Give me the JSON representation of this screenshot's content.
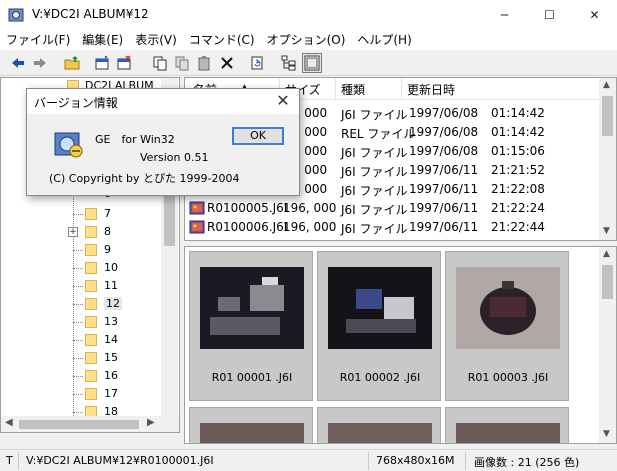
{
  "window": {
    "title": "V:¥DC2I ALBUM¥12",
    "minimize": "─",
    "maximize": "☐",
    "close": "✕"
  },
  "menu": [
    "ファイル(F)",
    "編集(E)",
    "表示(V)",
    "コマンド(C)",
    "オプション(O)",
    "ヘルプ(H)"
  ],
  "tree": {
    "root_label": "DC2I ALBUM",
    "items": [
      "7",
      "8",
      "9",
      "10",
      "11",
      "12",
      "13",
      "14",
      "15",
      "16",
      "17",
      "18"
    ],
    "expander_item": "8",
    "selected_item": "12",
    "partial_label": "6"
  },
  "filelist": {
    "columns": [
      "名前",
      "サイズ",
      "種類",
      "更新日時"
    ],
    "rows": [
      {
        "name": "",
        "size": "5, 000",
        "type": "J6I ファイル",
        "date": "1997/06/08",
        "time": "01:14:42"
      },
      {
        "name": "",
        "size": "5, 000",
        "type": "REL ファイル",
        "date": "1997/06/08",
        "time": "01:14:42"
      },
      {
        "name": "",
        "size": "5, 000",
        "type": "J6I ファイル",
        "date": "1997/06/08",
        "time": "01:15:06"
      },
      {
        "name": "",
        "size": "5, 000",
        "type": "J6I ファイル",
        "date": "1997/06/11",
        "time": "21:21:52"
      },
      {
        "name": "",
        "size": "5, 000",
        "type": "J6I ファイル",
        "date": "1997/06/11",
        "time": "21:22:08"
      },
      {
        "name": "R0100005.J6I",
        "size": "196, 000",
        "type": "J6I ファイル",
        "date": "1997/06/11",
        "time": "21:22:24"
      },
      {
        "name": "R0100006.J6I",
        "size": "196, 000",
        "type": "J6I ファイル",
        "date": "1997/06/11",
        "time": "21:22:44"
      }
    ]
  },
  "thumbnails": [
    {
      "caption": "R01 00001 .J6I"
    },
    {
      "caption": "R01 00002 .J6I"
    },
    {
      "caption": "R01 00003 .J6I"
    }
  ],
  "status": {
    "left": "T",
    "path": "V:¥DC2I ALBUM¥12¥R0100001.J6I",
    "dims": "768x480x16M",
    "count": "画像数 : 21 (256 色)"
  },
  "dialog": {
    "title": "バージョン情報",
    "app_name": "GE　for Win32",
    "version": "Version 0.51",
    "copyright": "(C) Copyright by とぴた 1999-2004",
    "ok": "OK",
    "close": "✕"
  },
  "colors": {
    "accent": "#3c7fd8",
    "folder": "#ffe08a",
    "panel": "#c8c8c8"
  }
}
